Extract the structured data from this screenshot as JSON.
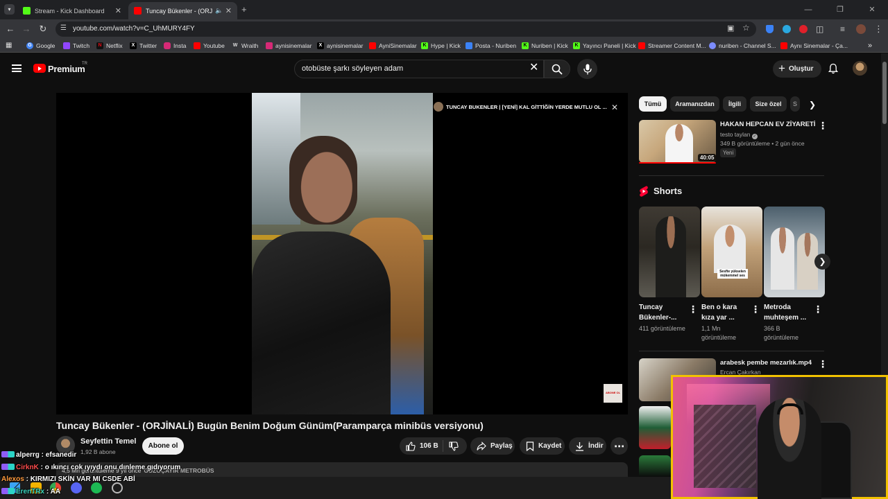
{
  "browser": {
    "tabs": [
      {
        "label": "Stream - Kick Dashboard",
        "active": false
      },
      {
        "label": "Tuncay Bükenler - (ORJİNAL",
        "active": true
      }
    ],
    "url": "youtube.com/watch?v=C_UhMURY4FY",
    "new_tab": "+",
    "bookmarks": [
      "Google",
      "Twitch",
      "Netflix",
      "Twitter",
      "Insta",
      "Youtube",
      "Wraith",
      "aynisinemalar",
      "aynisinemalar",
      "AyniSinemalar",
      "Hype | Kick",
      "Posta - Nuriben",
      "Nuriben | Kick",
      "Yayıncı Paneli | Kick",
      "Streamer Content M...",
      "nuriben - Channel S...",
      "Aynı Sinemalar - Ça..."
    ],
    "bookmarks_more": "»"
  },
  "youtube": {
    "brand": "Premium",
    "region": "TR",
    "search_value": "otobüste şarkı söyleyen adam",
    "create_label": "Oluştur"
  },
  "video": {
    "overlay_title": "TUNCAY BUKENLER | [YENİ] KAL GİTTİĞİN YERDE MUTLU OL ...",
    "watermark": "ABONE OL",
    "title": "Tuncay Bükenler - (ORJİNALİ) Bugün Benim Doğum Günüm(Paramparça minibüs versiyonu)",
    "channel": "Seyfettin Temel",
    "subs": "1,92 B abone",
    "subscribe_label": "Abone ol",
    "likes": "106 B",
    "share_label": "Paylaş",
    "save_label": "Kaydet",
    "download_label": "İndir",
    "views_meta": "4,5 Mn görüntüleme  9 yıl önce",
    "tag": "GÜZOÇAYIR METROBÜS"
  },
  "sidebar": {
    "chips": [
      "Tümü",
      "Aramanızdan",
      "İlgili",
      "Size özel",
      "S"
    ],
    "rec1": {
      "title": "HAKAN HEPCAN EV ZİYARETİ",
      "channel": "testo taylan",
      "meta": "349 B görüntüleme • 2 gün önce",
      "badge": "Yeni",
      "duration": "40:05"
    },
    "shorts_label": "Shorts",
    "shorts": [
      {
        "title": "Tuncay Bükenler-...",
        "views": "411 görüntüleme"
      },
      {
        "title": "Ben o kara kıza yar ...",
        "views": "1,1 Mn görüntüleme"
      },
      {
        "title": "Metroda muhteşem ...",
        "views": "366 B görüntüleme"
      }
    ],
    "short2_caption": "Sesfte yükselen mükemmel ses",
    "rec2": {
      "title": "arabesk pembe mezarlık.mp4",
      "channel": "Ercan Çakırkan"
    }
  },
  "chat": [
    {
      "user": "alperrg",
      "message": "efsanedir",
      "color": "#ffffff"
    },
    {
      "user": "CirknK",
      "message": "o ıkıncı cok ıyıydı onu dınleme gıdıyorum",
      "color": "#ff4d4d"
    },
    {
      "user": "Alexos",
      "message": "KIRMIZI SKİN VAR MI CSDE ABİ",
      "color": "#ff9a3c"
    },
    {
      "user": "ErenTRx",
      "message": "AA",
      "color": "#3cd6c0"
    }
  ]
}
